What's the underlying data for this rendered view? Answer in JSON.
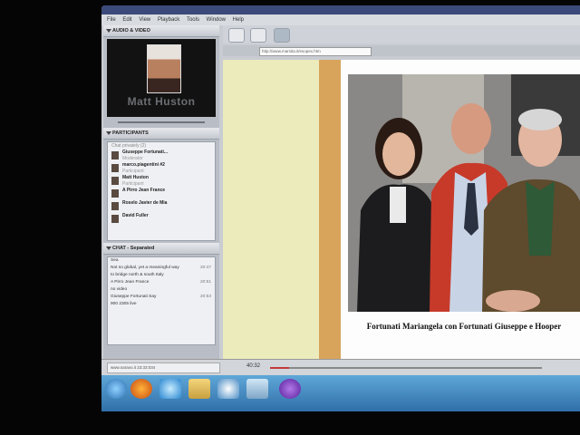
{
  "menu": [
    "File",
    "Edit",
    "View",
    "Playback",
    "Tools",
    "Window",
    "Help"
  ],
  "panels": {
    "audio_video": "AUDIO & VIDEO",
    "participants": "PARTICIPANTS",
    "chat": "CHAT - Separated"
  },
  "video": {
    "name": "Matt Huston"
  },
  "participants": {
    "hint": "Chat privately (2)",
    "items": [
      {
        "name": "Giuseppe Fortunati...",
        "sub": "Moderator"
      },
      {
        "name": "marco.piagentini #2",
        "sub": "Participant"
      },
      {
        "name": "Matt Huston",
        "sub": "Participant"
      },
      {
        "name": "A Pirro Jean France",
        "sub": ""
      },
      {
        "name": "Roselo Javier de Mia",
        "sub": ""
      },
      {
        "name": "David Fuller",
        "sub": ""
      }
    ]
  },
  "chat": {
    "lines": [
      {
        "text": "Sea",
        "time": ""
      },
      {
        "text": "Not so global, yet a meaningful way",
        "time": "20:47"
      },
      {
        "text": "to bridge north & south Italy",
        "time": ""
      },
      {
        "text": "A Pirro Jean France",
        "time": "20:51"
      },
      {
        "text": "no video",
        "time": ""
      },
      {
        "text": "Giuseppe Fortunati Say",
        "time": "20:53"
      },
      {
        "text": "900 2305 live",
        "time": ""
      }
    ]
  },
  "url": "http://www.marsita.it/esopex.htm",
  "caption": "Fortunati Mariangela con Fortunati Giuseppe e Hooper",
  "status": "www.naravo.it  23:33:034",
  "timecode": "40:32",
  "playback_progress": 0.07,
  "colors": {
    "accent": "#3b4a7a",
    "progress": "#c23b3b",
    "taskbar": "#2f6fa8"
  }
}
